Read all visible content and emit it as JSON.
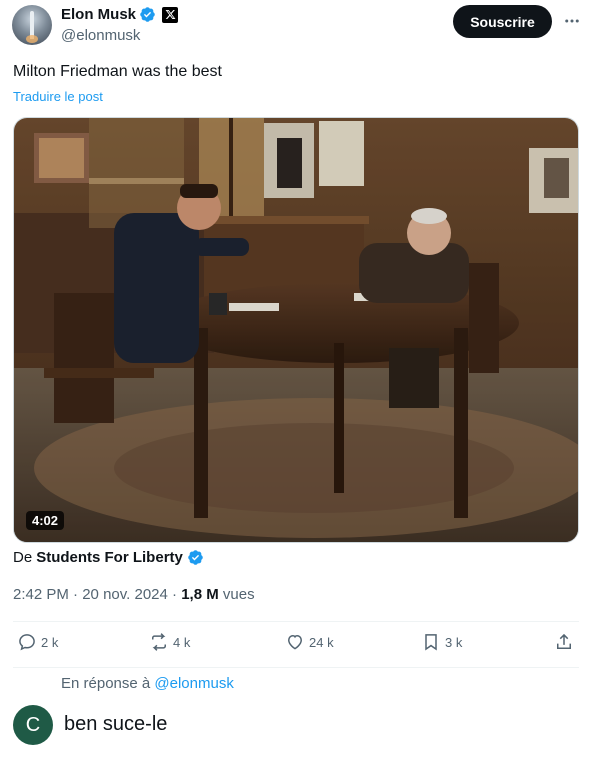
{
  "author": {
    "name": "Elon Musk",
    "handle": "@elonmusk",
    "verified_color": "#1d9bf0"
  },
  "header": {
    "follow_label": "Souscrire",
    "more_icon": "more-horizontal-icon"
  },
  "post": {
    "text": "Milton Friedman was the best",
    "translate_label": "Traduire le post"
  },
  "video": {
    "duration": "4:02"
  },
  "source": {
    "prefix": "De",
    "name": "Students For Liberty"
  },
  "meta": {
    "time": "2:42 PM",
    "date": "20 nov. 2024",
    "views_count": "1,8 M",
    "views_label": "vues",
    "separator": "·"
  },
  "actions": {
    "replies": "2 k",
    "reposts": "4 k",
    "likes": "24 k",
    "bookmarks": "3 k"
  },
  "reply": {
    "prefix": "En réponse à",
    "mention": "@elonmusk",
    "avatar_letter": "C",
    "avatar_color": "#1f5a46",
    "text": "ben suce-le"
  },
  "colors": {
    "accent": "#1d9bf0",
    "text": "#0f1419",
    "muted": "#536471"
  }
}
